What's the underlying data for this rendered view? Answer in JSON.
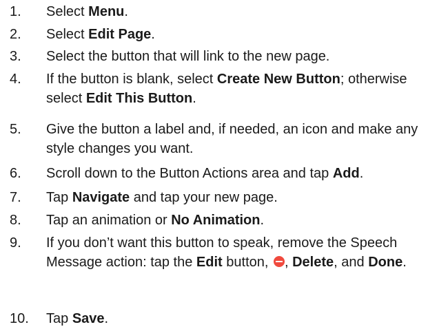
{
  "steps": [
    {
      "num": "1.",
      "parts": [
        {
          "t": "Select "
        },
        {
          "t": "Menu",
          "b": true
        },
        {
          "t": "."
        }
      ]
    },
    {
      "num": "2.",
      "parts": [
        {
          "t": "Select "
        },
        {
          "t": "Edit Page",
          "b": true
        },
        {
          "t": "."
        }
      ]
    },
    {
      "num": "3.",
      "parts": [
        {
          "t": "Select the button that will link to the new page."
        }
      ]
    },
    {
      "num": "4.",
      "parts": [
        {
          "t": "If the button is blank, select "
        },
        {
          "t": "Create New Button",
          "b": true
        },
        {
          "t": "; otherwise select "
        },
        {
          "t": "Edit This Button",
          "b": true
        },
        {
          "t": "."
        }
      ]
    },
    {
      "num": "5.",
      "parts": [
        {
          "t": "Give the button a label and, if needed, an icon and make any style changes you want."
        }
      ]
    },
    {
      "num": "6.",
      "parts": [
        {
          "t": "Scroll down to the Button Actions area and tap "
        },
        {
          "t": "Add",
          "b": true
        },
        {
          "t": "."
        }
      ]
    },
    {
      "num": "7.",
      "parts": [
        {
          "t": "Tap "
        },
        {
          "t": "Navigate",
          "b": true
        },
        {
          "t": " and tap your new page."
        }
      ]
    },
    {
      "num": "8.",
      "parts": [
        {
          "t": "Tap an animation or "
        },
        {
          "t": "No Animation",
          "b": true
        },
        {
          "t": "."
        }
      ]
    },
    {
      "num": "9.",
      "parts": [
        {
          "t": "If you don’t want this button to speak, remove the Speech Message action: tap the "
        },
        {
          "t": "Edit",
          "b": true
        },
        {
          "t": " button, "
        },
        {
          "icon": "remove-icon"
        },
        {
          "t": ", "
        },
        {
          "t": "Delete",
          "b": true
        },
        {
          "t": ", and "
        },
        {
          "t": "Done",
          "b": true
        },
        {
          "t": "."
        }
      ]
    },
    {
      "num": "10.",
      "parts": [
        {
          "t": "Tap "
        },
        {
          "t": "Save",
          "b": true
        },
        {
          "t": "."
        }
      ]
    }
  ],
  "icon_color": "#f04a3e"
}
